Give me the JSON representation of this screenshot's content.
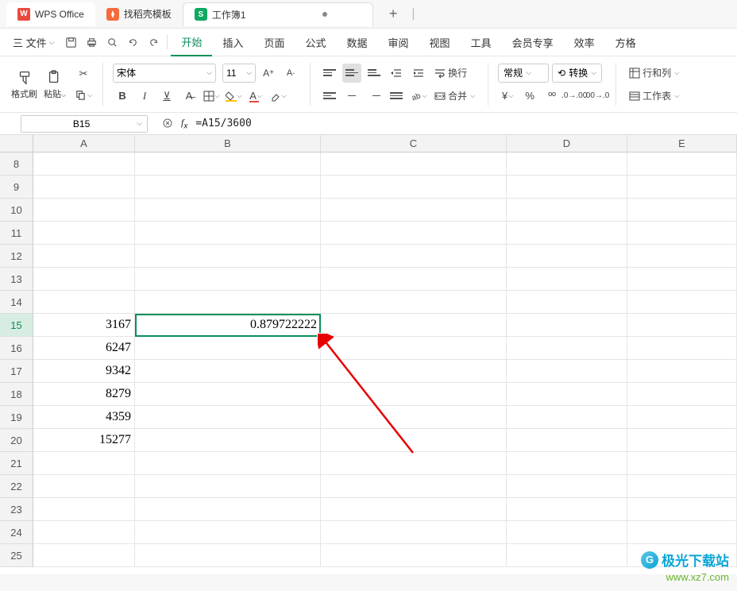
{
  "titlebar": {
    "app_name": "WPS Office",
    "template_tab": "找稻壳模板",
    "workbook_tab": "工作簿1",
    "add_tab": "+"
  },
  "menubar": {
    "file": "三 文件",
    "items": [
      "开始",
      "插入",
      "页面",
      "公式",
      "数据",
      "审阅",
      "视图",
      "工具",
      "会员专享",
      "效率",
      "方格"
    ],
    "active_index": 0
  },
  "ribbon": {
    "format_painter": "格式刷",
    "paste": "粘贴",
    "font_name": "宋体",
    "font_size": "11",
    "wrap_text": "换行",
    "merge": "合并",
    "number_format": "常规",
    "transform": "转换",
    "row_col": "行和列",
    "worksheet": "工作表"
  },
  "formula_bar": {
    "cell_ref": "B15",
    "formula": "=A15/3600"
  },
  "grid": {
    "columns": [
      "A",
      "B",
      "C",
      "D",
      "E"
    ],
    "visible_rows": [
      8,
      9,
      10,
      11,
      12,
      13,
      14,
      15,
      16,
      17,
      18,
      19,
      20,
      21,
      22,
      23,
      24,
      25
    ],
    "data": {
      "A15": "3167",
      "A16": "6247",
      "A17": "9342",
      "A18": "8279",
      "A19": "4359",
      "A20": "15277",
      "B15": "0.879722222"
    },
    "selected_cell": "B15"
  },
  "watermark": {
    "line1": "极光下载站",
    "line2": "www.xz7.com"
  },
  "colors": {
    "primary": "#0a8f5a",
    "accent_red": "#e94a3f",
    "accent_yellow": "#ffc107"
  }
}
